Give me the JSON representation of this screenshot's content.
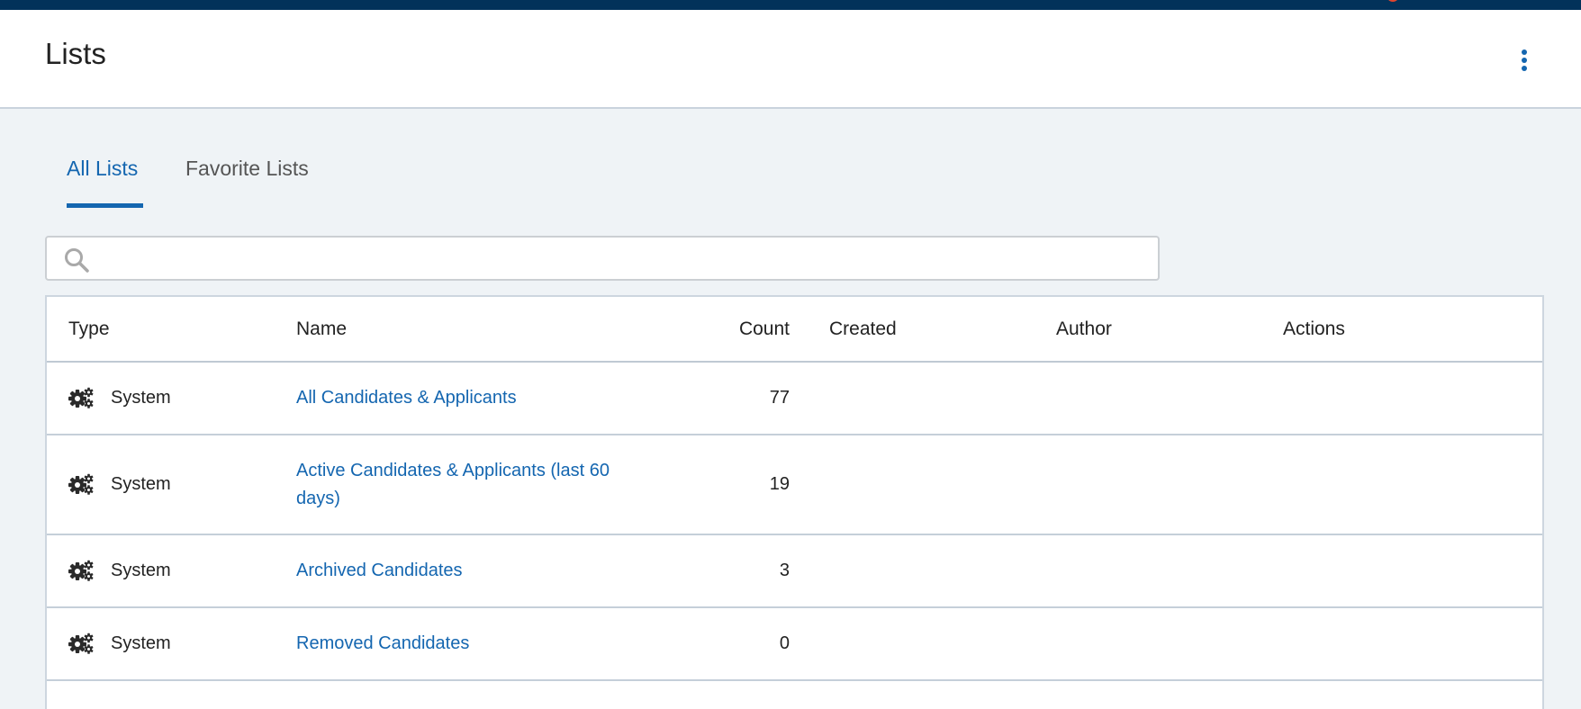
{
  "header": {
    "title": "Lists",
    "more_icon": "more-vertical-icon"
  },
  "tabs": [
    {
      "label": "All Lists",
      "active": true
    },
    {
      "label": "Favorite Lists",
      "active": false
    }
  ],
  "search": {
    "placeholder": "",
    "value": "",
    "icon": "search-icon"
  },
  "table": {
    "columns": [
      "Type",
      "Name",
      "Count",
      "Created",
      "Author",
      "Actions"
    ],
    "rows": [
      {
        "type": "System",
        "type_icon": "gears-icon",
        "name": "All Candidates & Applicants",
        "count": "77",
        "created": "",
        "author": ""
      },
      {
        "type": "System",
        "type_icon": "gears-icon",
        "name": "Active Candidates & Applicants (last 60 days)",
        "count": "19",
        "created": "",
        "author": ""
      },
      {
        "type": "System",
        "type_icon": "gears-icon",
        "name": "Archived Candidates",
        "count": "3",
        "created": "",
        "author": ""
      },
      {
        "type": "System",
        "type_icon": "gears-icon",
        "name": "Removed Candidates",
        "count": "0",
        "created": "",
        "author": ""
      }
    ]
  },
  "colors": {
    "accent": "#1466b0",
    "topbar": "#02325a",
    "background": "#eff3f6"
  }
}
